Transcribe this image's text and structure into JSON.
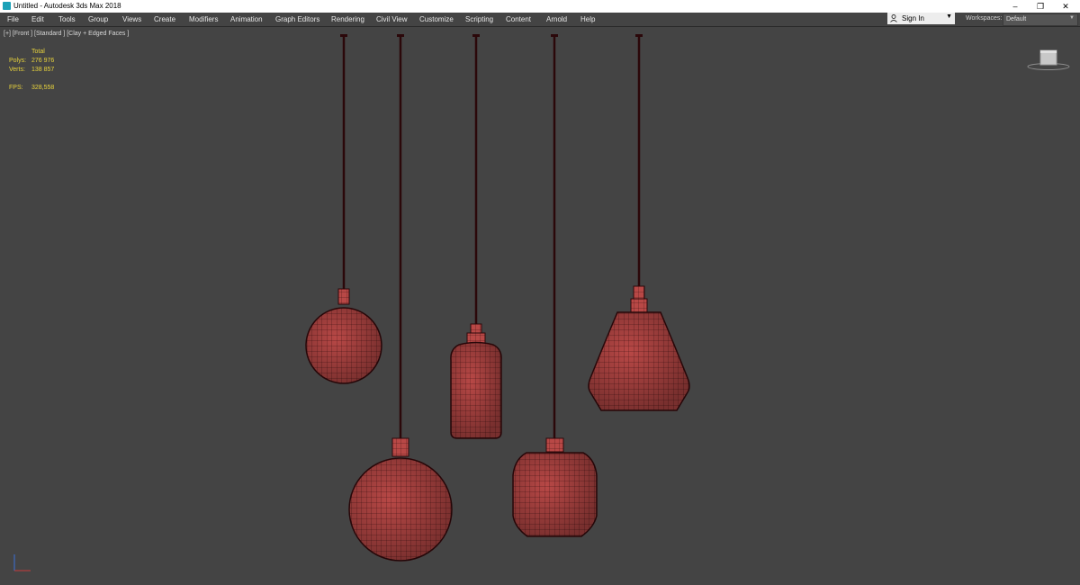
{
  "window": {
    "title": "Untitled - Autodesk 3ds Max 2018",
    "minimize": "–",
    "restore": "❐",
    "close": "✕"
  },
  "menu": [
    "File",
    "Edit",
    "Tools",
    "Group",
    "Views",
    "Create",
    "Modifiers",
    "Animation",
    "Graph Editors",
    "Rendering",
    "Civil View",
    "Customize",
    "Scripting",
    "Content",
    "Arnold",
    "Help"
  ],
  "signin": {
    "label": "Sign In"
  },
  "workspaces": {
    "label": "Workspaces:",
    "value": "Default"
  },
  "viewport": {
    "label": "[+] [Front ] [Standard ] [Clay + Edged Faces ]",
    "stats": {
      "header": "Total",
      "polys_label": "Polys:",
      "polys_value": "276 976",
      "verts_label": "Verts:",
      "verts_value": "138 857",
      "fps_label": "FPS:",
      "fps_value": "328,558"
    }
  },
  "colors": {
    "viewport_bg": "#444444",
    "lamp_fill": "#b84846",
    "wire": "#3a0d10",
    "stat_text": "#e8d33c"
  }
}
